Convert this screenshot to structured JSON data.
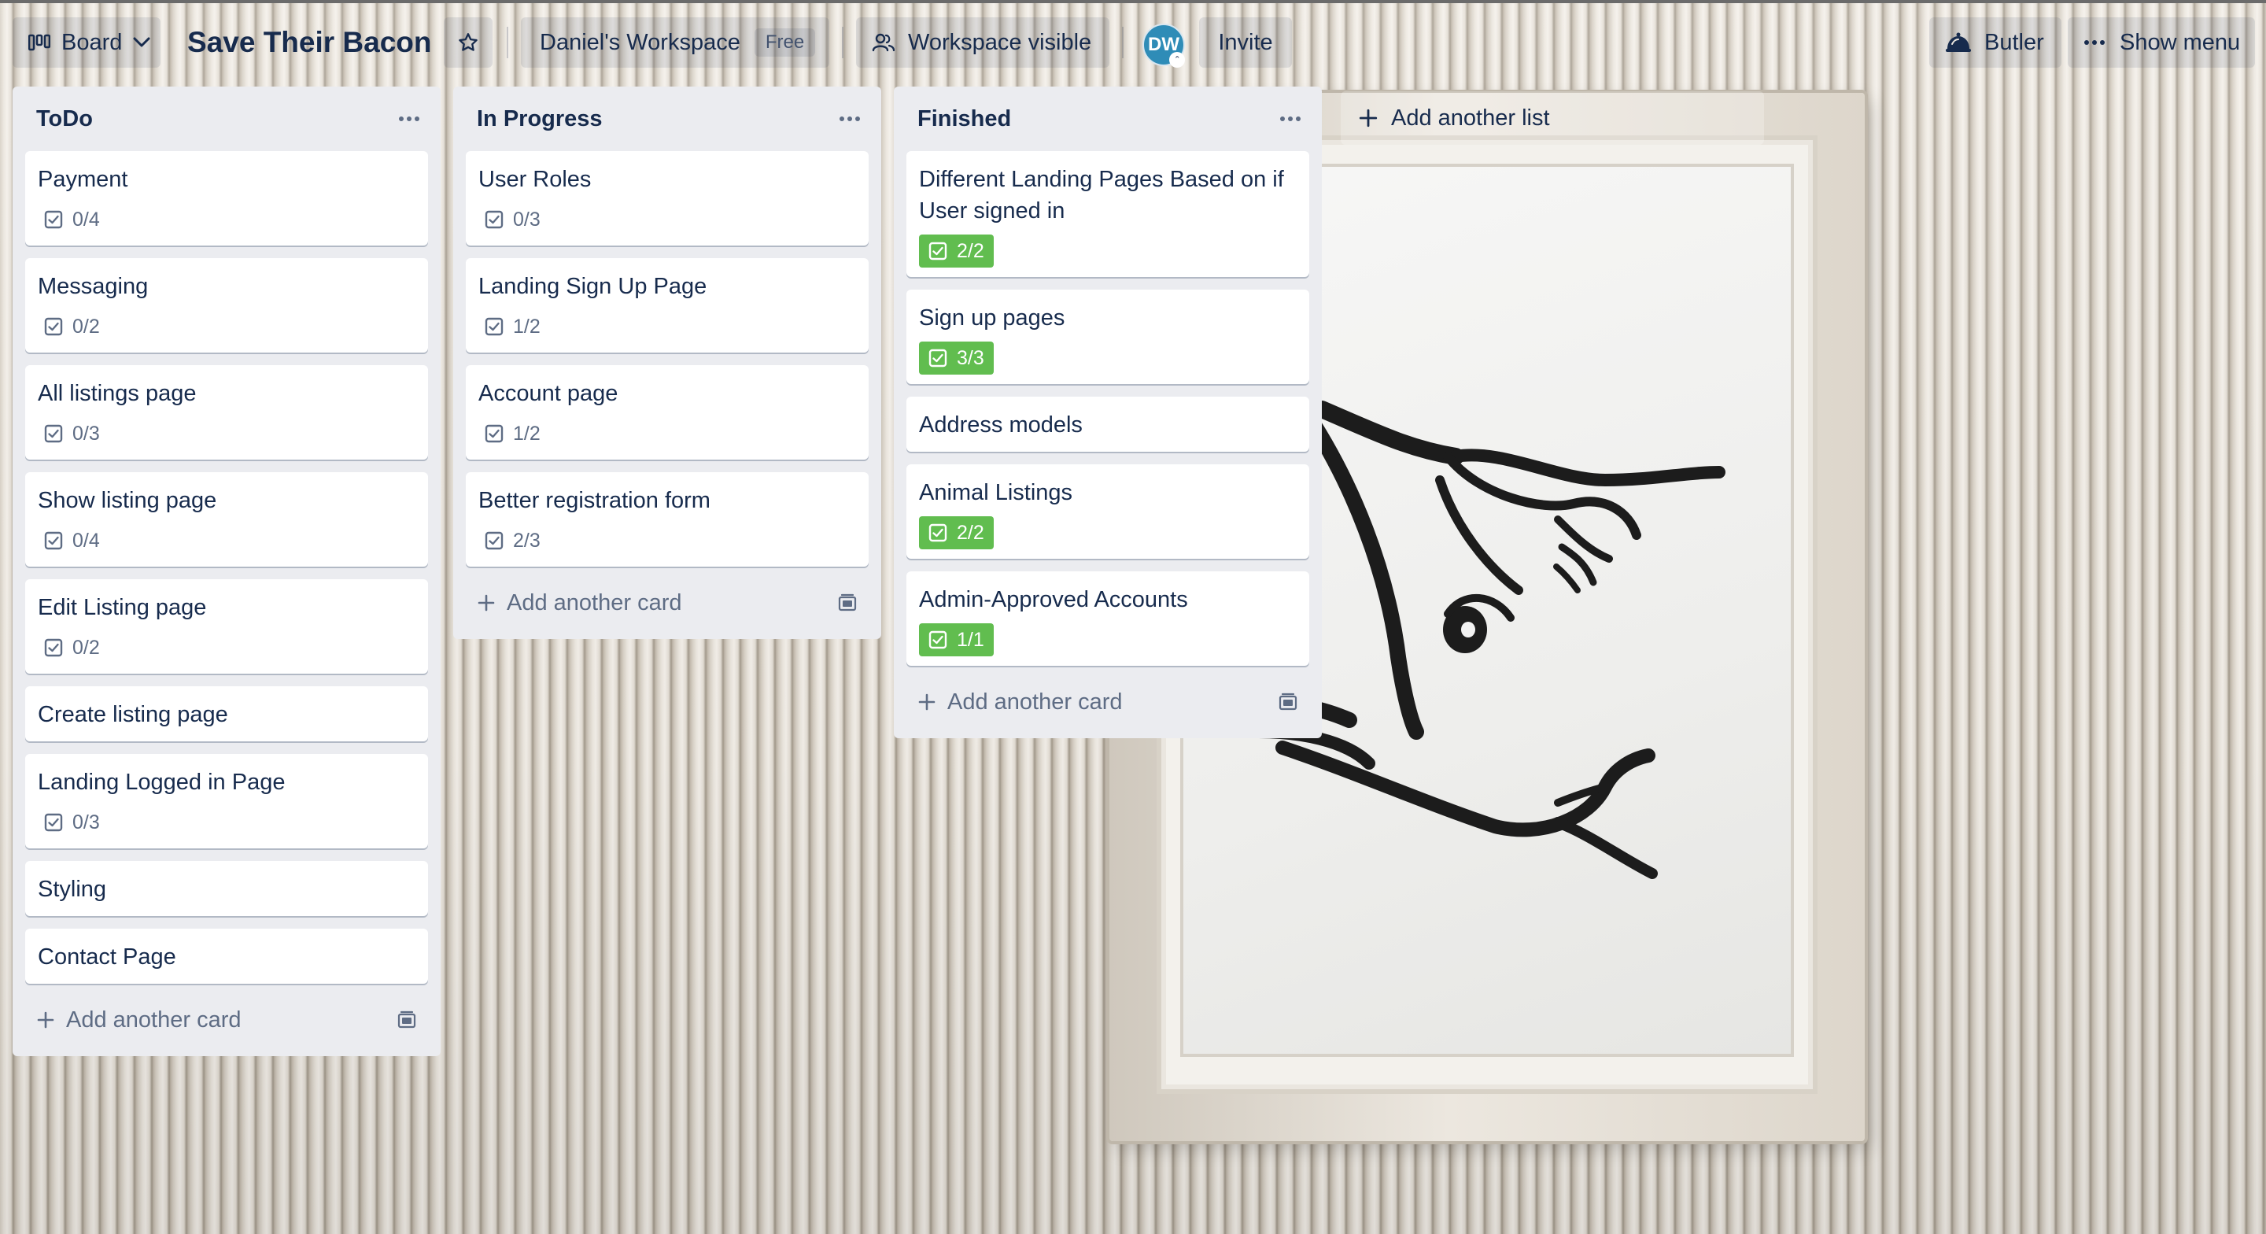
{
  "header": {
    "view_label": "Board",
    "board_title": "Save Their Bacon",
    "workspace_name": "Daniel's Workspace",
    "workspace_badge": "Free",
    "visibility_label": "Workspace visible",
    "avatar_initials": "DW",
    "invite_label": "Invite",
    "butler_label": "Butler",
    "show_menu_label": "Show menu"
  },
  "lists": [
    {
      "title": "ToDo",
      "cards": [
        {
          "title": "Payment",
          "checklist": "0/4",
          "complete": false
        },
        {
          "title": "Messaging",
          "checklist": "0/2",
          "complete": false
        },
        {
          "title": "All listings page",
          "checklist": "0/3",
          "complete": false
        },
        {
          "title": "Show listing page",
          "checklist": "0/4",
          "complete": false
        },
        {
          "title": "Edit Listing page",
          "checklist": "0/2",
          "complete": false
        },
        {
          "title": "Create listing page",
          "checklist": null,
          "complete": false
        },
        {
          "title": "Landing Logged in Page",
          "checklist": "0/3",
          "complete": false
        },
        {
          "title": "Styling",
          "checklist": null,
          "complete": false
        },
        {
          "title": "Contact Page",
          "checklist": null,
          "complete": false
        }
      ],
      "add_card_label": "Add another card"
    },
    {
      "title": "In Progress",
      "cards": [
        {
          "title": "User Roles",
          "checklist": "0/3",
          "complete": false
        },
        {
          "title": "Landing Sign Up Page",
          "checklist": "1/2",
          "complete": false
        },
        {
          "title": "Account page",
          "checklist": "1/2",
          "complete": false
        },
        {
          "title": "Better registration form",
          "checklist": "2/3",
          "complete": false
        }
      ],
      "add_card_label": "Add another card"
    },
    {
      "title": "Finished",
      "cards": [
        {
          "title": "Different Landing Pages Based on if User signed in",
          "checklist": "2/2",
          "complete": true
        },
        {
          "title": "Sign up pages",
          "checklist": "3/3",
          "complete": true
        },
        {
          "title": "Address models",
          "checklist": null,
          "complete": false
        },
        {
          "title": "Animal Listings",
          "checklist": "2/2",
          "complete": true
        },
        {
          "title": "Admin-Approved Accounts",
          "checklist": "1/1",
          "complete": true
        }
      ],
      "add_card_label": "Add another card"
    }
  ],
  "add_list_label": "Add another list",
  "colors": {
    "list_bg": "#ebecf0",
    "card_bg": "#ffffff",
    "checklist_complete": "#61bd4f",
    "text_primary": "#172b4d",
    "text_muted": "#5e6c84",
    "avatar_bg": "#2f8cb7"
  },
  "icons": {
    "view": "board-icon",
    "view_dropdown": "chevron-down-icon",
    "star": "star-icon",
    "visibility": "people-icon",
    "butler": "butler-icon",
    "show_menu": "ellipsis-icon",
    "list_menu": "ellipsis-icon",
    "checklist": "checkbox-icon",
    "add": "plus-icon",
    "template": "card-template-icon"
  }
}
